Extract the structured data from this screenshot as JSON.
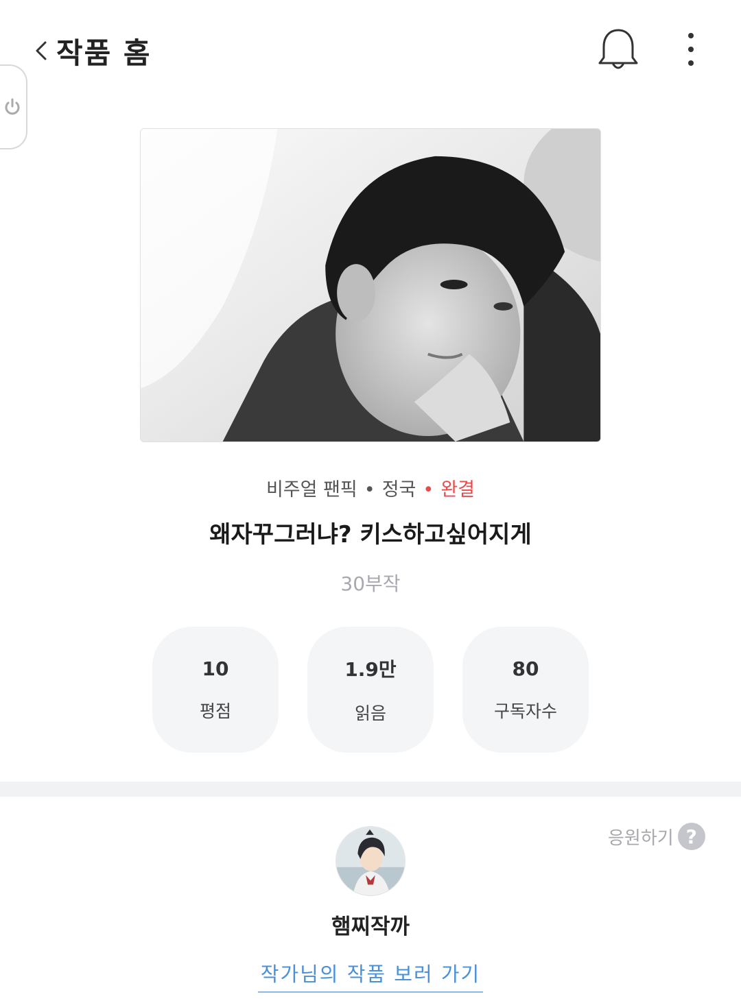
{
  "header": {
    "title": "작품 홈"
  },
  "work": {
    "genre": "비주얼 팬픽",
    "character": "정국",
    "status": "완결",
    "status_color": "#e94b4b",
    "title": "왜자꾸그러냐? 키스하고싶어지게",
    "episodes": "30부작"
  },
  "stats": [
    {
      "value": "10",
      "label": "평점"
    },
    {
      "value": "1.9만",
      "label": "읽음"
    },
    {
      "value": "80",
      "label": "구독자수"
    }
  ],
  "author": {
    "cheer_label": "응원하기",
    "help_glyph": "?",
    "name": "햄찌작까",
    "link_label": "작가님의 작품 보러 가기",
    "link_color": "#4a90d9"
  },
  "icons": {
    "back": "chevron-left-icon",
    "bell": "bell-icon",
    "more": "more-vertical-icon",
    "power": "power-icon"
  }
}
